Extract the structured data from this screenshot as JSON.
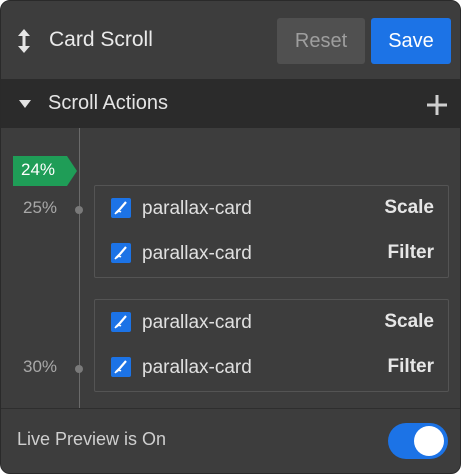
{
  "header": {
    "icon": "vertical-arrows-icon",
    "title": "Card Scroll",
    "reset_label": "Reset",
    "save_label": "Save"
  },
  "section": {
    "title": "Scroll Actions",
    "icon": "plus-icon"
  },
  "timeline": {
    "current_marker": "24%",
    "labels": [
      "25%",
      "30%"
    ]
  },
  "groups": [
    {
      "rows": [
        {
          "name": "parallax-card",
          "action": "Scale",
          "checked": true
        },
        {
          "name": "parallax-card",
          "action": "Filter",
          "checked": true
        }
      ]
    },
    {
      "rows": [
        {
          "name": "parallax-card",
          "action": "Scale",
          "checked": true
        },
        {
          "name": "parallax-card",
          "action": "Filter",
          "checked": true
        }
      ]
    }
  ],
  "footer": {
    "label": "Live Preview is On",
    "toggle_on": true
  },
  "colors": {
    "accent": "#1c73e6",
    "marker": "#1f9d57",
    "panel": "#3d3d3d",
    "section": "#2b2b2b"
  }
}
